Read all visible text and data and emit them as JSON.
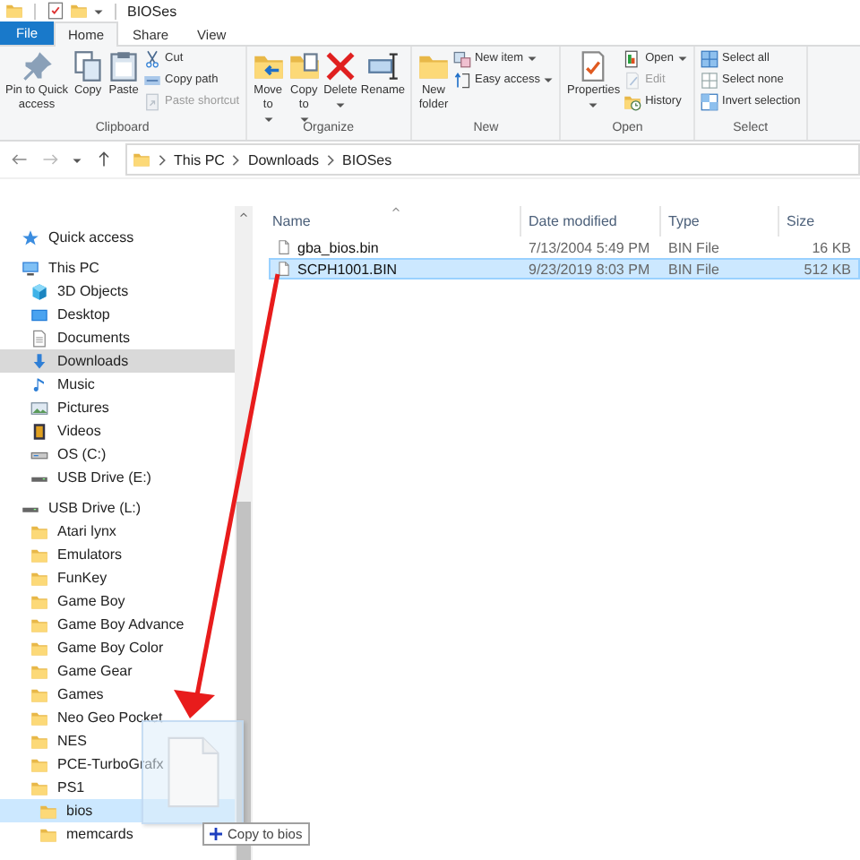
{
  "window": {
    "title": "BIOSes"
  },
  "ribbon_tabs": [
    {
      "label": "File",
      "kind": "menu",
      "selected": false
    },
    {
      "label": "Home",
      "kind": "tab",
      "selected": true
    },
    {
      "label": "Share",
      "kind": "tab",
      "selected": false
    },
    {
      "label": "View",
      "kind": "tab",
      "selected": false
    }
  ],
  "ribbon_groups": [
    {
      "label": "Clipboard",
      "commands": [
        {
          "label": "Pin to Quick access",
          "kind": "large",
          "dropdown": false,
          "disabled": false
        },
        {
          "label": "Copy",
          "kind": "large",
          "dropdown": false,
          "disabled": false
        },
        {
          "label": "Paste",
          "kind": "large",
          "dropdown": false,
          "disabled": false
        },
        {
          "label": "Cut",
          "kind": "small",
          "dropdown": false,
          "disabled": false
        },
        {
          "label": "Copy path",
          "kind": "small",
          "dropdown": false,
          "disabled": false
        },
        {
          "label": "Paste shortcut",
          "kind": "small",
          "dropdown": false,
          "disabled": true
        }
      ]
    },
    {
      "label": "Organize",
      "commands": [
        {
          "label": "Move to",
          "kind": "large",
          "dropdown": true,
          "disabled": false
        },
        {
          "label": "Copy to",
          "kind": "large",
          "dropdown": true,
          "disabled": false
        },
        {
          "label": "Delete",
          "kind": "large",
          "dropdown": true,
          "disabled": false
        },
        {
          "label": "Rename",
          "kind": "large",
          "dropdown": false,
          "disabled": false
        }
      ]
    },
    {
      "label": "New",
      "commands": [
        {
          "label": "New folder",
          "kind": "large",
          "dropdown": false,
          "disabled": false
        },
        {
          "label": "New item",
          "kind": "small",
          "dropdown": true,
          "disabled": false
        },
        {
          "label": "Easy access",
          "kind": "small",
          "dropdown": true,
          "disabled": false
        }
      ]
    },
    {
      "label": "Open",
      "commands": [
        {
          "label": "Properties",
          "kind": "large",
          "dropdown": true,
          "disabled": false
        },
        {
          "label": "Open",
          "kind": "small",
          "dropdown": true,
          "disabled": false
        },
        {
          "label": "Edit",
          "kind": "small",
          "dropdown": false,
          "disabled": true
        },
        {
          "label": "History",
          "kind": "small",
          "dropdown": false,
          "disabled": false
        }
      ]
    },
    {
      "label": "Select",
      "commands": [
        {
          "label": "Select all",
          "kind": "small",
          "dropdown": false,
          "disabled": false
        },
        {
          "label": "Select none",
          "kind": "small",
          "dropdown": false,
          "disabled": false
        },
        {
          "label": "Invert selection",
          "kind": "small",
          "dropdown": false,
          "disabled": false
        }
      ]
    }
  ],
  "address": {
    "path": [
      "This PC",
      "Downloads",
      "BIOSes"
    ]
  },
  "navigation": [
    {
      "label": "Quick access",
      "kind": "star",
      "selected": false,
      "drop_target": false
    },
    {
      "label": "This PC",
      "kind": "pc",
      "selected": false,
      "drop_target": false,
      "children": [
        {
          "label": "3D Objects",
          "kind": "cube",
          "selected": false,
          "drop_target": false
        },
        {
          "label": "Desktop",
          "kind": "desktop",
          "selected": false,
          "drop_target": false
        },
        {
          "label": "Documents",
          "kind": "documents",
          "selected": false,
          "drop_target": false
        },
        {
          "label": "Downloads",
          "kind": "download",
          "selected": true,
          "drop_target": false
        },
        {
          "label": "Music",
          "kind": "music",
          "selected": false,
          "drop_target": false
        },
        {
          "label": "Pictures",
          "kind": "pictures",
          "selected": false,
          "drop_target": false
        },
        {
          "label": "Videos",
          "kind": "video",
          "selected": false,
          "drop_target": false
        },
        {
          "label": "OS (C:)",
          "kind": "drive",
          "selected": false,
          "drop_target": false
        },
        {
          "label": "USB Drive (E:)",
          "kind": "usb",
          "selected": false,
          "drop_target": false
        }
      ]
    },
    {
      "label": "USB Drive (L:)",
      "kind": "usb",
      "selected": false,
      "drop_target": false,
      "children": [
        {
          "label": "Atari lynx",
          "kind": "folder",
          "selected": false,
          "drop_target": false
        },
        {
          "label": "Emulators",
          "kind": "folder",
          "selected": false,
          "drop_target": false
        },
        {
          "label": "FunKey",
          "kind": "folder",
          "selected": false,
          "drop_target": false
        },
        {
          "label": "Game Boy",
          "kind": "folder",
          "selected": false,
          "drop_target": false
        },
        {
          "label": "Game Boy Advance",
          "kind": "folder",
          "selected": false,
          "drop_target": false
        },
        {
          "label": "Game Boy Color",
          "kind": "folder",
          "selected": false,
          "drop_target": false
        },
        {
          "label": "Game Gear",
          "kind": "folder",
          "selected": false,
          "drop_target": false
        },
        {
          "label": "Games",
          "kind": "folder",
          "selected": false,
          "drop_target": false
        },
        {
          "label": "Neo Geo Pocket",
          "kind": "folder",
          "selected": false,
          "drop_target": false
        },
        {
          "label": "NES",
          "kind": "folder",
          "selected": false,
          "drop_target": false
        },
        {
          "label": "PCE-TurboGrafx",
          "kind": "folder",
          "selected": false,
          "drop_target": false
        },
        {
          "label": "PS1",
          "kind": "folder",
          "selected": false,
          "drop_target": false,
          "children": [
            {
              "label": "bios",
              "kind": "folder",
              "selected": false,
              "drop_target": true
            },
            {
              "label": "memcards",
              "kind": "folder",
              "selected": false,
              "drop_target": false
            }
          ]
        }
      ]
    }
  ],
  "files": {
    "columns": [
      "Name",
      "Date modified",
      "Type",
      "Size"
    ],
    "rows": [
      {
        "name": "gba_bios.bin",
        "date_modified": "7/13/2004 5:49 PM",
        "type": "BIN File",
        "size": "16 KB",
        "selected": false
      },
      {
        "name": "SCPH1001.BIN",
        "date_modified": "9/23/2019 8:03 PM",
        "type": "BIN File",
        "size": "512 KB",
        "selected": true
      }
    ]
  },
  "drag_tooltip": {
    "text": "Copy to bios"
  }
}
